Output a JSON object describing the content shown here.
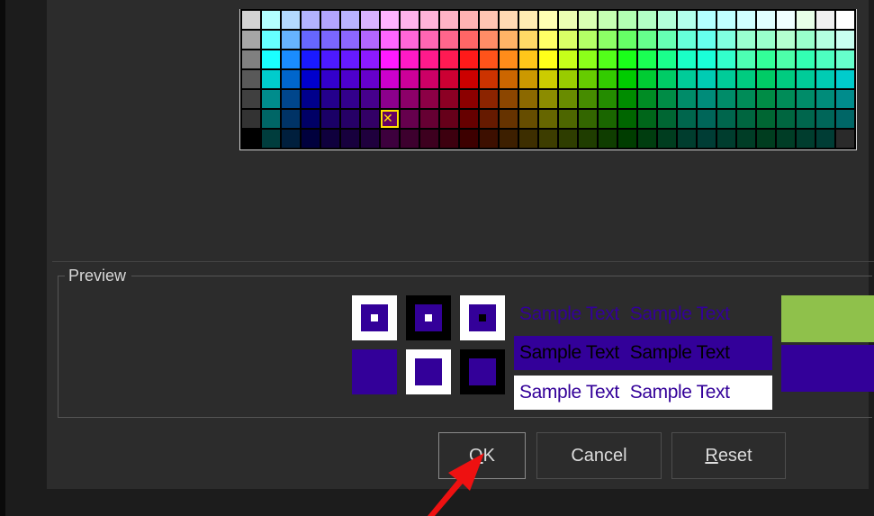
{
  "palette": {
    "columns": 31,
    "selected": {
      "row": 5,
      "col": 7
    },
    "rows": [
      [
        "#d3d3d3",
        "#b3ffff",
        "#b3d9ff",
        "#b3b3ff",
        "#b3a5ff",
        "#b9b3ff",
        "#d9b3ff",
        "#ffb3ff",
        "#ffb3ec",
        "#ffb3d9",
        "#ffb3c5",
        "#ffb3b3",
        "#ffc5b3",
        "#ffd9b3",
        "#ffecb3",
        "#ffffb3",
        "#ecffb3",
        "#d9ffb3",
        "#c5ffb3",
        "#b3ffb3",
        "#b3ffc5",
        "#b3ffd9",
        "#b3ffec",
        "#b3ffff",
        "#c0ffff",
        "#d0ffff",
        "#e0ffff",
        "#f0ffff",
        "#e8ffe8",
        "#f0f0f0",
        "#ffffff"
      ],
      [
        "#a6a6a6",
        "#66ffff",
        "#66b3ff",
        "#6666ff",
        "#7a66ff",
        "#8c66ff",
        "#b366ff",
        "#ff66ff",
        "#ff66d9",
        "#ff66b3",
        "#ff668c",
        "#ff6666",
        "#ff8c66",
        "#ffb366",
        "#ffd966",
        "#ffff66",
        "#d9ff66",
        "#b3ff66",
        "#8cff66",
        "#66ff66",
        "#66ff8c",
        "#66ffb3",
        "#66ffd9",
        "#66ffee",
        "#80ffe0",
        "#99ffd0",
        "#99ffcc",
        "#b3ffd0",
        "#99ffcc",
        "#b3ffe0",
        "#c8fff0"
      ],
      [
        "#808080",
        "#1affff",
        "#1a8cff",
        "#1a1aff",
        "#4d1aff",
        "#661aff",
        "#8c1aff",
        "#ff1aff",
        "#ff1ac6",
        "#ff1a8c",
        "#ff1a53",
        "#ff1a1a",
        "#ff531a",
        "#ff8c1a",
        "#ffc61a",
        "#ffff1a",
        "#c6ff1a",
        "#8cff1a",
        "#53ff1a",
        "#1aff1a",
        "#1aff53",
        "#1aff8c",
        "#1affc6",
        "#1affd9",
        "#33ffcc",
        "#4dffb3",
        "#33ff99",
        "#4dffaa",
        "#33ffb3",
        "#4dffc0",
        "#66ffcc"
      ],
      [
        "#595959",
        "#00cccc",
        "#0066cc",
        "#0000cc",
        "#3300cc",
        "#4d00cc",
        "#6600cc",
        "#cc00cc",
        "#cc0099",
        "#cc0066",
        "#cc0033",
        "#cc0000",
        "#cc3300",
        "#cc6600",
        "#cc9900",
        "#cccc00",
        "#99cc00",
        "#66cc00",
        "#33cc00",
        "#00cc00",
        "#00cc33",
        "#00cc66",
        "#00cc99",
        "#00ccb3",
        "#00cc99",
        "#00cc80",
        "#00cc66",
        "#00cc80",
        "#00cc99",
        "#00ccb3",
        "#00cccc"
      ],
      [
        "#404040",
        "#008c8c",
        "#00468c",
        "#00008c",
        "#24008c",
        "#33008c",
        "#46008c",
        "#8c008c",
        "#8c0069",
        "#8c0046",
        "#8c0024",
        "#8c0000",
        "#8c2400",
        "#8c4600",
        "#8c6900",
        "#8c8c00",
        "#698c00",
        "#468c00",
        "#248c00",
        "#008c00",
        "#008c24",
        "#008c46",
        "#008c69",
        "#008c7a",
        "#008c69",
        "#008c58",
        "#008c46",
        "#008c58",
        "#008c69",
        "#008c7a",
        "#008c8c"
      ],
      [
        "#333333",
        "#006666",
        "#003366",
        "#000066",
        "#1a0066",
        "#260066",
        "#330066",
        "#660066",
        "#66004d",
        "#660033",
        "#66001a",
        "#660000",
        "#661a00",
        "#663300",
        "#664d00",
        "#666600",
        "#4d6600",
        "#336600",
        "#1a6600",
        "#006600",
        "#00661a",
        "#006633",
        "#00664d",
        "#006659",
        "#00664d",
        "#006640",
        "#006633",
        "#006640",
        "#00664d",
        "#006659",
        "#006666"
      ],
      [
        "#000000",
        "#003d3d",
        "#001f3d",
        "#00003d",
        "#0f003d",
        "#17003d",
        "#1f003d",
        "#3d003d",
        "#3d002e",
        "#3d001f",
        "#3d000f",
        "#3d0000",
        "#3d0f00",
        "#3d1f00",
        "#3d2e00",
        "#3d3d00",
        "#2e3d00",
        "#1f3d00",
        "#0f3d00",
        "#003d00",
        "#003d0f",
        "#003d1f",
        "#003d2e",
        "#003d35",
        "#003d2e",
        "#003d26",
        "#003d1f",
        "#003d26",
        "#003d2e",
        "#003d35",
        "#2a2a2a"
      ]
    ]
  },
  "preview": {
    "label": "Preview",
    "foreground_color": "#330099",
    "background_color": "#ffffff",
    "alt_background": "#000000",
    "highlight_color": "#8fc14b",
    "sample_text": "Sample Text",
    "sample_rows": [
      {
        "fg": "#330099",
        "bg": "#2c2c2c"
      },
      {
        "fg": "#000000",
        "bg": "#330099"
      },
      {
        "fg": "#330099",
        "bg": "#ffffff"
      }
    ],
    "color_bars": [
      "#8fc14b",
      "#330099"
    ]
  },
  "buttons": {
    "ok": {
      "label": "OK",
      "mnemonic": "O"
    },
    "cancel": {
      "label": "Cancel"
    },
    "reset": {
      "label": "Reset",
      "mnemonic": "R"
    }
  },
  "annotation": {
    "icon": "red-arrow-icon",
    "color": "#ee1111"
  }
}
